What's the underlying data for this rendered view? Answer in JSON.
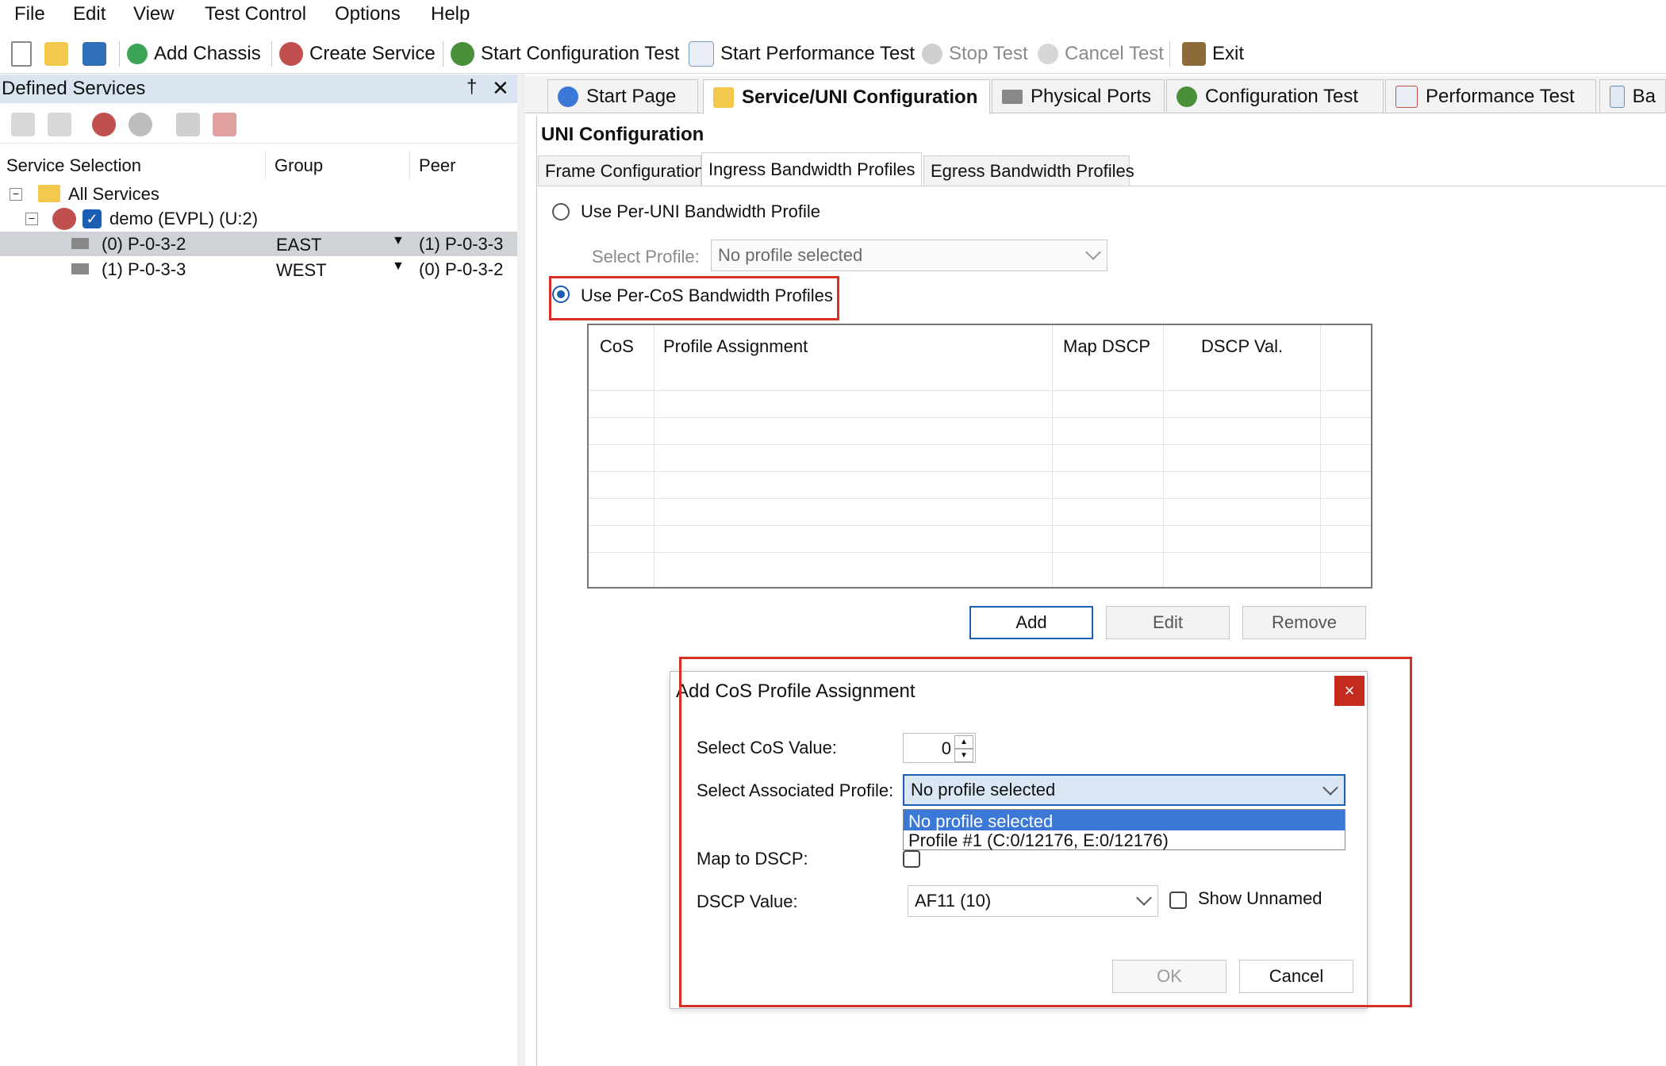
{
  "menu": [
    "File",
    "Edit",
    "View",
    "Test Control",
    "Options",
    "Help"
  ],
  "toolbar": {
    "add_chassis": "Add Chassis",
    "create_service": "Create Service",
    "start_config": "Start Configuration Test",
    "start_perf": "Start Performance Test",
    "stop_test": "Stop Test",
    "cancel_test": "Cancel Test",
    "exit": "Exit"
  },
  "left": {
    "title": "Defined Services",
    "pin": "†",
    "close": "✕",
    "cols": {
      "service": "Service Selection",
      "group": "Group",
      "peer": "Peer"
    },
    "tree": {
      "all": "All Services",
      "service": "demo (EVPL) (U:2)",
      "rows": [
        {
          "port": "(0) P-0-3-2",
          "group": "EAST",
          "peer": "(1) P-0-3-3"
        },
        {
          "port": "(1) P-0-3-3",
          "group": "WEST",
          "peer": "(0) P-0-3-2"
        }
      ]
    }
  },
  "tabs": [
    "Start Page",
    "Service/UNI Configuration",
    "Physical Ports",
    "Configuration Test",
    "Performance Test",
    "Ba"
  ],
  "uni": {
    "title": "UNI Configuration",
    "subtabs": [
      "Frame Configuration",
      "Ingress Bandwidth Profiles",
      "Egress Bandwidth Profiles"
    ],
    "per_uni": "Use Per-UNI Bandwidth Profile",
    "select_profile_label": "Select Profile:",
    "select_profile_value": "No profile selected",
    "per_cos": "Use Per-CoS Bandwidth Profiles",
    "grid_cols": [
      "CoS",
      "Profile Assignment",
      "Map DSCP",
      "DSCP Val."
    ],
    "buttons": {
      "add": "Add",
      "edit": "Edit",
      "remove": "Remove"
    }
  },
  "dialog": {
    "title": "Add CoS Profile Assignment",
    "close": "×",
    "cos_label": "Select CoS Value:",
    "cos_value": "0",
    "profile_label": "Select Associated Profile:",
    "profile_value": "No profile selected",
    "options": [
      "No profile selected",
      "Profile #1 (C:0/12176, E:0/12176)"
    ],
    "map_label": "Map to DSCP:",
    "dscp_label": "DSCP Value:",
    "dscp_value": "AF11 (10)",
    "show_unnamed": "Show Unnamed",
    "ok": "OK",
    "cancel": "Cancel"
  },
  "colors": {
    "accent": "#1a5fb4",
    "highlight": "#d93025",
    "selection": "#3b78d8"
  }
}
